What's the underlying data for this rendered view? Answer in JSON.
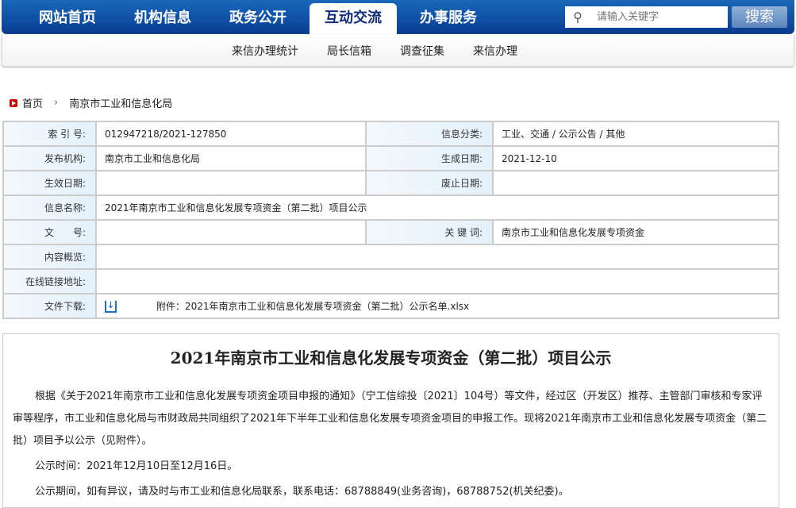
{
  "nav": {
    "tabs": [
      "网站首页",
      "机构信息",
      "政务公开",
      "互动交流",
      "办事服务"
    ],
    "active": 3,
    "search_placeholder": "请输入关键字",
    "search_button": "搜索"
  },
  "subnav": [
    "来信办理统计",
    "局长信箱",
    "调查征集",
    "来信办理"
  ],
  "breadcrumb": {
    "home": "首页",
    "sep": "›",
    "current": "南京市工业和信息化局"
  },
  "meta": {
    "index_label": "索 引 号:",
    "index": "012947218/2021-127850",
    "category_label": "信息分类:",
    "category": "工业、交通 / 公示公告 / 其他",
    "publisher_label": "发布机构:",
    "publisher": "南京市工业和信息化局",
    "created_label": "生成日期:",
    "created": "2021-12-10",
    "effective_label": "生效日期:",
    "abolished_label": "废止日期:",
    "name_label": "信息名称:",
    "name": "2021年南京市工业和信息化发展专项资金（第二批）项目公示",
    "docno_label": "文　　号:",
    "keywords_label": "关 键 词:",
    "keywords": "南京市工业和信息化发展专项资金",
    "summary_label": "内容概览:",
    "link_label": "在线链接地址:",
    "download_label": "文件下载:",
    "attachment": "附件：2021年南京市工业和信息化发展专项资金（第二批）公示名单.xlsx"
  },
  "article": {
    "title": "2021年南京市工业和信息化发展专项资金（第二批）项目公示",
    "p1": "根据《关于2021年南京市工业和信息化发展专项资金项目申报的通知》（宁工信综投〔2021〕104号）等文件，经过区（开发区）推荐、主管部门审核和专家评审等程序，市工业和信息化局与市财政局共同组织了2021年下半年工业和信息化发展专项资金项目的申报工作。现将2021年南京市工业和信息化发展专项资金（第二批）项目予以公示（见附件）。",
    "p2": "公示时间：2021年12月10日至12月16日。",
    "p3": "公示期间，如有异议，请及时与市工业和信息化局联系，联系电话：68788849(业务咨询)，68788752(机关纪委)。"
  }
}
